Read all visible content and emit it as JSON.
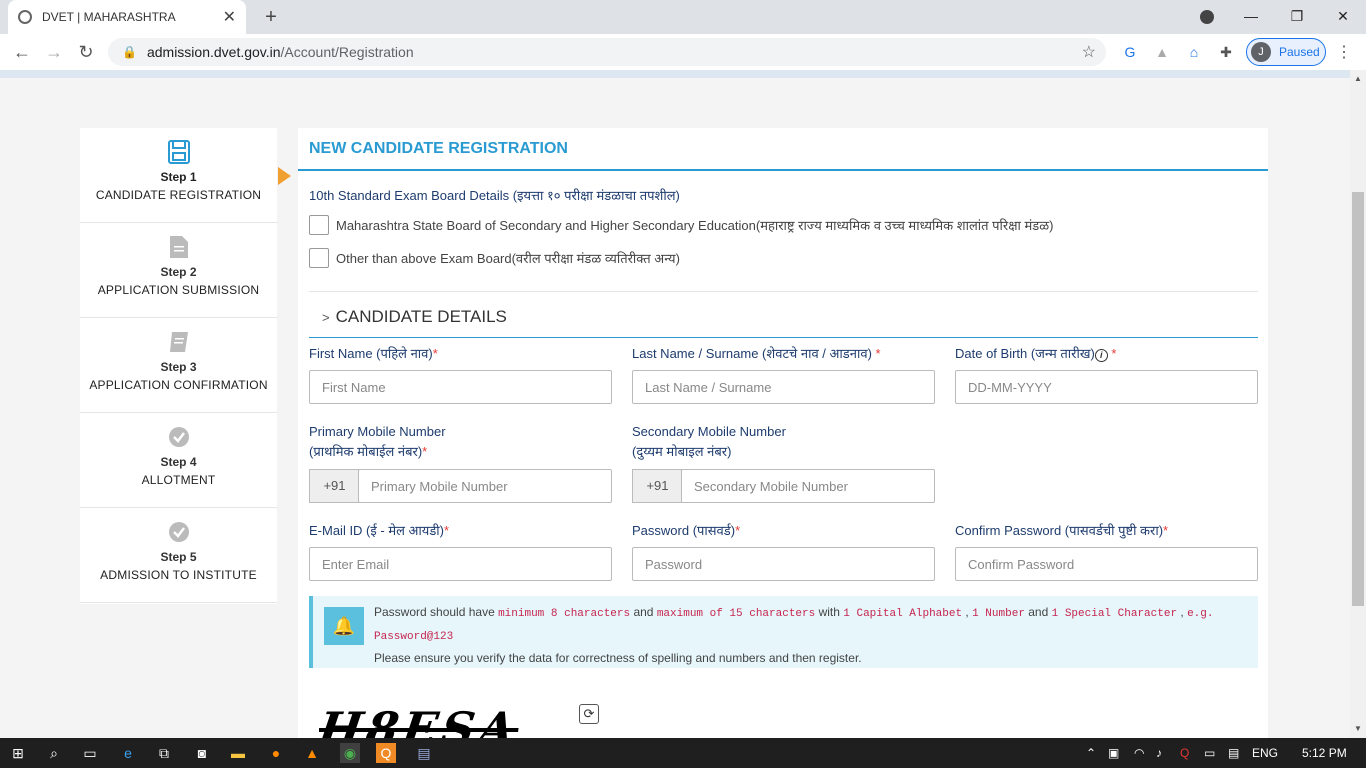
{
  "browser": {
    "tab_title": "DVET | MAHARASHTRA",
    "tab_close": "✕",
    "new_tab": "+",
    "url_host": "admission.dvet.gov.in",
    "url_path": "/Account/Registration",
    "profile_initial": "J",
    "profile_status": "Paused"
  },
  "steps": [
    {
      "num": "Step 1",
      "name": "CANDIDATE REGISTRATION",
      "icon": "floppy-disk-icon"
    },
    {
      "num": "Step 2",
      "name": "APPLICATION SUBMISSION",
      "icon": "document-icon"
    },
    {
      "num": "Step 3",
      "name": "APPLICATION CONFIRMATION",
      "icon": "book-icon"
    },
    {
      "num": "Step 4",
      "name": "ALLOTMENT",
      "icon": "check-circle-icon"
    },
    {
      "num": "Step 5",
      "name": "ADMISSION TO INSTITUTE",
      "icon": "check-circle-icon"
    }
  ],
  "form": {
    "heading": "NEW CANDIDATE REGISTRATION",
    "board_label": "10th Standard Exam Board Details (इयत्ता १० परीक्षा मंडळाचा तपशील)",
    "board_options": [
      "Maharashtra State Board of Secondary and Higher Secondary Education(महाराष्ट्र राज्य माध्यमिक व उच्च माध्यमिक शालांत परिक्षा मंडळ)",
      "Other than above Exam Board(वरील परीक्षा मंडळ व्यतिरीक्त अन्य)"
    ],
    "section_title": "CANDIDATE DETAILS",
    "first_name_label": "First Name (पहिले नाव)",
    "first_name_placeholder": "First Name",
    "last_name_label": "Last Name / Surname (शेवटचे नाव / आडनाव) ",
    "last_name_placeholder": "Last Name / Surname",
    "dob_label": "Date of Birth (जन्म तारीख)",
    "dob_placeholder": "DD-MM-YYYY",
    "primary_mobile_label_1": "Primary Mobile Number",
    "primary_mobile_label_2": "(प्राथमिक मोबाईल नंबर)",
    "primary_mobile_placeholder": "Primary Mobile Number",
    "secondary_mobile_label_1": "Secondary Mobile Number",
    "secondary_mobile_label_2": "(दुय्यम मोबाइल नंबर)",
    "secondary_mobile_placeholder": "Secondary Mobile Number",
    "country_code": "+91",
    "email_label": "E-Mail ID (ई - मेल आयडी)",
    "email_placeholder": "Enter Email",
    "password_label": "Password (पासवर्ड)",
    "password_placeholder": "Password",
    "confirm_label": "Confirm Password (पासवर्डची पुष्टी करा)",
    "confirm_placeholder": "Confirm Password",
    "required_mark": "*"
  },
  "notice": {
    "p1": "Password should have ",
    "c1": "minimum 8 characters",
    "p2": " and ",
    "c2": "maximum of 15 characters",
    "p3": " with ",
    "c3": "1 Capital Alphabet",
    "p4": " , ",
    "c4": "1 Number",
    "p5": " and ",
    "c5": "1 Special Character",
    "p6": " , ",
    "c6": "e.g. Password@123",
    "line2": "Please ensure you verify the data for correctness of spelling and numbers and then register."
  },
  "captcha": {
    "text": "H8ESA"
  },
  "taskbar": {
    "lang": "ENG",
    "time": "5:12 PM"
  },
  "colors": {
    "accent": "#2a9bd2",
    "arrow": "#f0a030",
    "required": "#e53935",
    "notice_bg": "#e6f6fb"
  }
}
